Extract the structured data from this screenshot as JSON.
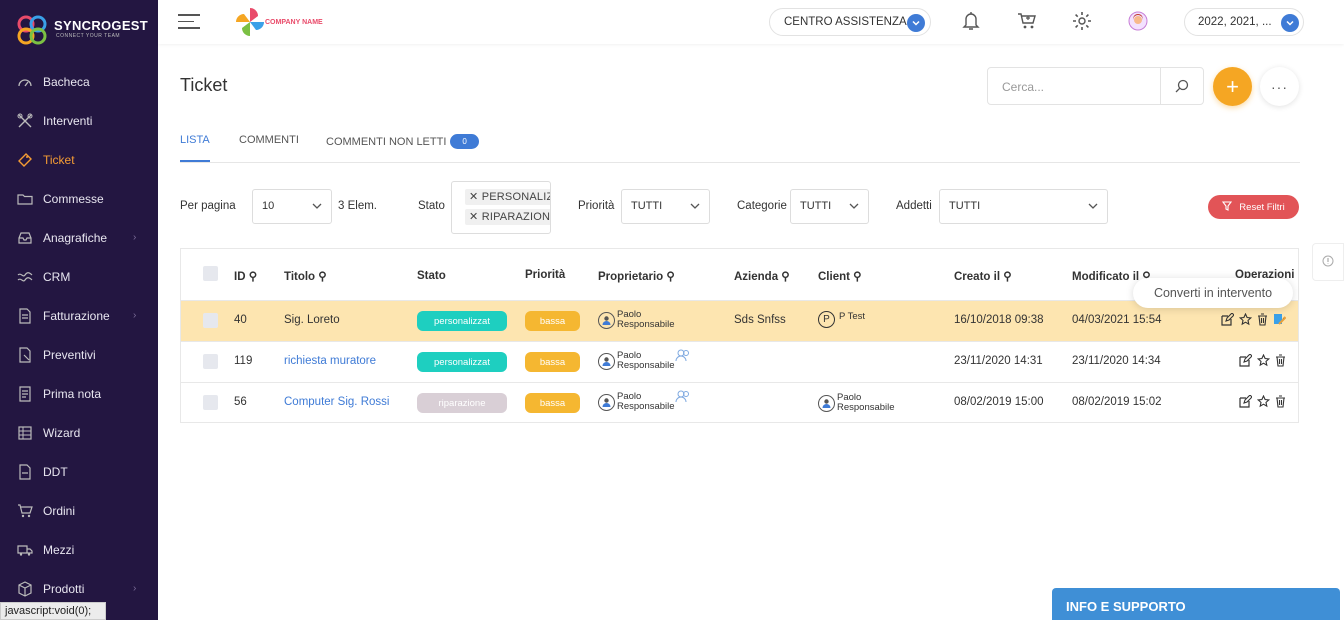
{
  "brand": {
    "name": "SYNCROGEST",
    "tagline": "CONNECT YOUR TEAM",
    "company_logo_text": "COMPANY NAME"
  },
  "sidebar": {
    "items": [
      {
        "label": "Bacheca",
        "icon": "dashboard-icon"
      },
      {
        "label": "Interventi",
        "icon": "tools-icon"
      },
      {
        "label": "Ticket",
        "icon": "ticket-icon",
        "active": true
      },
      {
        "label": "Commesse",
        "icon": "folder-icon"
      },
      {
        "label": "Anagrafiche",
        "icon": "inbox-icon",
        "has_submenu": true
      },
      {
        "label": "CRM",
        "icon": "crm-icon"
      },
      {
        "label": "Fatturazione",
        "icon": "invoice-icon",
        "has_submenu": true
      },
      {
        "label": "Preventivi",
        "icon": "quote-icon"
      },
      {
        "label": "Prima nota",
        "icon": "notes-icon"
      },
      {
        "label": "Wizard",
        "icon": "wizard-icon"
      },
      {
        "label": "DDT",
        "icon": "ddt-icon"
      },
      {
        "label": "Ordini",
        "icon": "cart-icon"
      },
      {
        "label": "Mezzi",
        "icon": "truck-icon"
      },
      {
        "label": "Prodotti",
        "icon": "box-icon",
        "has_submenu": true
      }
    ]
  },
  "topbar": {
    "assist_label": "CENTRO ASSISTENZA",
    "years_label": "2022, 2021, ..."
  },
  "page": {
    "title": "Ticket",
    "search_placeholder": "Cerca...",
    "add_symbol": "+",
    "more_symbol": "···"
  },
  "tabs": [
    {
      "label": "LISTA",
      "active": true
    },
    {
      "label": "COMMENTI"
    },
    {
      "label": "COMMENTI NON LETTI",
      "badge": "0"
    }
  ],
  "filters": {
    "per_page_label": "Per pagina",
    "per_page_value": "10",
    "count_label": "3 Elem.",
    "stato_label": "Stato",
    "stato_tags": [
      "PERSONALIZZ",
      "RIPARAZIONE"
    ],
    "priorita_label": "Priorità",
    "priorita_value": "TUTTI",
    "categorie_label": "Categorie",
    "categorie_value": "TUTTI",
    "addetti_label": "Addetti",
    "addetti_value": "TUTTI",
    "reset_label": "Reset Filtri"
  },
  "table": {
    "headers": {
      "id": "ID",
      "titolo": "Titolo",
      "stato": "Stato",
      "priorita": "Priorità",
      "proprietario": "Proprietario",
      "azienda": "Azienda",
      "client": "Client",
      "creato": "Creato il",
      "modificato": "Modificato il",
      "operazioni": "Operazioni"
    },
    "rows": [
      {
        "id": "40",
        "titolo": "Sig. Loreto",
        "stato": "personalizzat",
        "stato_color": "#1ecfc0",
        "priorita": "bassa",
        "proprietario": [
          "Paolo",
          "Responsabile"
        ],
        "azienda": "Sds Snfss",
        "client_initial": "P",
        "client": "P Test",
        "creato": "16/10/2018 09:38",
        "modificato": "04/03/2021 15:54"
      },
      {
        "id": "119",
        "titolo": "richiesta muratore",
        "stato": "personalizzat",
        "stato_color": "#1ecfc0",
        "priorita": "bassa",
        "proprietario": [
          "Paolo",
          "Responsabile"
        ],
        "azienda": "",
        "client": "",
        "creato": "23/11/2020 14:31",
        "modificato": "23/11/2020 14:34"
      },
      {
        "id": "56",
        "titolo": "Computer Sig. Rossi",
        "stato": "riparazione",
        "stato_color": "#d9cfd6",
        "priorita": "bassa",
        "proprietario": [
          "Paolo",
          "Responsabile"
        ],
        "azienda": "",
        "client_person": [
          "Paolo",
          "Responsabile"
        ],
        "creato": "08/02/2019 15:00",
        "modificato": "08/02/2019 15:02"
      }
    ]
  },
  "tooltip": "Converti in intervento",
  "support_label": "INFO E SUPPORTO",
  "status_url": "javascript:void(0);",
  "colors": {
    "sidebar_bg": "#231641",
    "accent": "#f5a623",
    "primary": "#3f7bd6",
    "highlight_row": "#fde5b0",
    "danger": "#e25457"
  }
}
